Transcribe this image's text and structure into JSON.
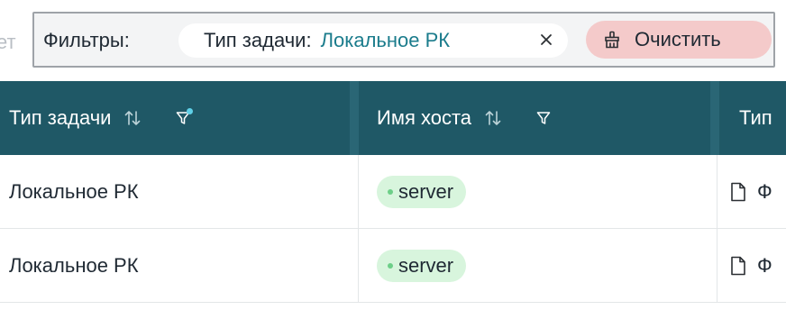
{
  "filter_bar": {
    "cut_text": "ет",
    "label": "Фильтры:",
    "chip": {
      "key": "Тип задачи:",
      "value": "Локальное РК",
      "close_icon": "close-icon"
    },
    "clear_button": {
      "label": "Очистить",
      "icon": "broom-icon"
    }
  },
  "table": {
    "columns": [
      {
        "label": "Тип задачи",
        "sort_icon": "sort-icon",
        "filter_icon": "filter-icon",
        "filter_active": true
      },
      {
        "label": "Имя хоста",
        "sort_icon": "sort-icon",
        "filter_icon": "filter-icon",
        "filter_active": false
      },
      {
        "label": "Тип"
      }
    ],
    "rows": [
      {
        "task_type": "Локальное РК",
        "host": "server",
        "type_icon": "document-icon",
        "type_text": "Ф"
      },
      {
        "task_type": "Локальное РК",
        "host": "server",
        "type_icon": "document-icon",
        "type_text": "Ф"
      }
    ]
  },
  "colors": {
    "header_bg": "#1f5866",
    "chip_value": "#1b7c8c",
    "clear_button_bg": "#f4caca",
    "tag_bg": "#d8f5dd",
    "filter_active_dot": "#5fd0e8"
  }
}
